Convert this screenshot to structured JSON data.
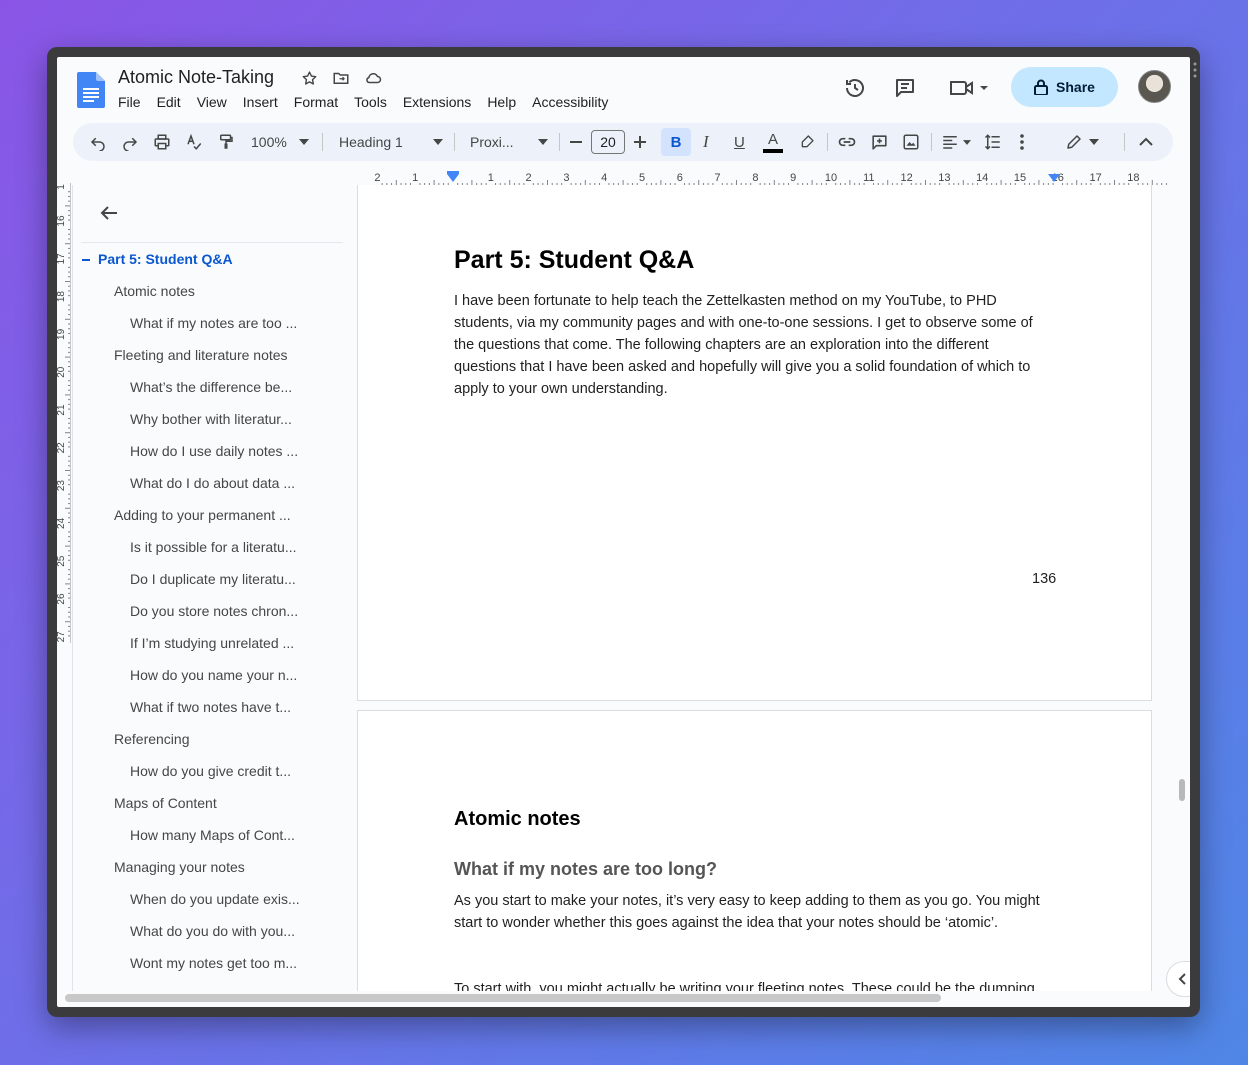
{
  "app": {
    "title": "Atomic Note-Taking",
    "menus": [
      "File",
      "Edit",
      "View",
      "Insert",
      "Format",
      "Tools",
      "Extensions",
      "Help",
      "Accessibility"
    ],
    "share_label": "Share",
    "accent": "#0b57d0",
    "share_bg": "#c2e7ff"
  },
  "toolbar": {
    "zoom": "100%",
    "style": "Heading 1",
    "font": "Proxi...",
    "font_size": "20",
    "bold": "B",
    "italic": "I",
    "underline": "U",
    "text_color": "A"
  },
  "ruler": {
    "h_labels": [
      "2",
      "1",
      "1",
      "2",
      "3",
      "4",
      "5",
      "6",
      "7",
      "8",
      "9",
      "10",
      "11",
      "12",
      "13",
      "14",
      "15",
      "16",
      "17",
      "18"
    ],
    "v_labels": [
      "1",
      "16",
      "17",
      "18",
      "19",
      "20",
      "21",
      "22",
      "23",
      "24",
      "25",
      "26",
      "27"
    ]
  },
  "outline": {
    "items": [
      {
        "level": 1,
        "label": "Part 5: Student Q&A"
      },
      {
        "level": 2,
        "label": "Atomic notes"
      },
      {
        "level": 3,
        "label": "What if my notes are too ..."
      },
      {
        "level": 2,
        "label": "Fleeting and literature notes"
      },
      {
        "level": 3,
        "label": "What’s the difference be..."
      },
      {
        "level": 3,
        "label": "Why bother with literatur..."
      },
      {
        "level": 3,
        "label": "How do I use daily notes ..."
      },
      {
        "level": 3,
        "label": "What do I do about data ..."
      },
      {
        "level": 2,
        "label": "Adding to your permanent ..."
      },
      {
        "level": 3,
        "label": "Is it possible for a literatu..."
      },
      {
        "level": 3,
        "label": "Do I duplicate my literatu..."
      },
      {
        "level": 3,
        "label": "Do you store notes chron..."
      },
      {
        "level": 3,
        "label": "If I’m studying unrelated ..."
      },
      {
        "level": 3,
        "label": "How do you name your n..."
      },
      {
        "level": 3,
        "label": "What if two notes have t..."
      },
      {
        "level": 2,
        "label": "Referencing"
      },
      {
        "level": 3,
        "label": "How do you give credit t..."
      },
      {
        "level": 2,
        "label": "Maps of Content"
      },
      {
        "level": 3,
        "label": "How many Maps of Cont..."
      },
      {
        "level": 2,
        "label": "Managing your notes"
      },
      {
        "level": 3,
        "label": "When do you update exis..."
      },
      {
        "level": 3,
        "label": "What do you do with you..."
      },
      {
        "level": 3,
        "label": "Wont my notes get too m..."
      }
    ]
  },
  "document": {
    "page1": {
      "heading": "Part 5: Student Q&A",
      "body": "I have been fortunate to help teach the Zettelkasten method on my YouTube, to PHD students, via my community pages and with one-to-one sessions. I get to observe some of the questions that come. The following chapters are an exploration into the different questions that I have been asked and hopefully will give you a solid foundation of which to apply to your own understanding.",
      "page_number": "136"
    },
    "page2": {
      "heading": "Atomic notes",
      "subheading": "What if my notes are too long?",
      "para1": "As you start to make your notes, it’s very easy to keep adding to them as you go. You might start to wonder whether this goes against the idea that your notes should be ‘atomic’.",
      "para2": "To start with, you might actually be writing your fleeting notes. These could be the dumping ground of highlights, ideas or questions you have as you read a book or complete any course material."
    }
  }
}
